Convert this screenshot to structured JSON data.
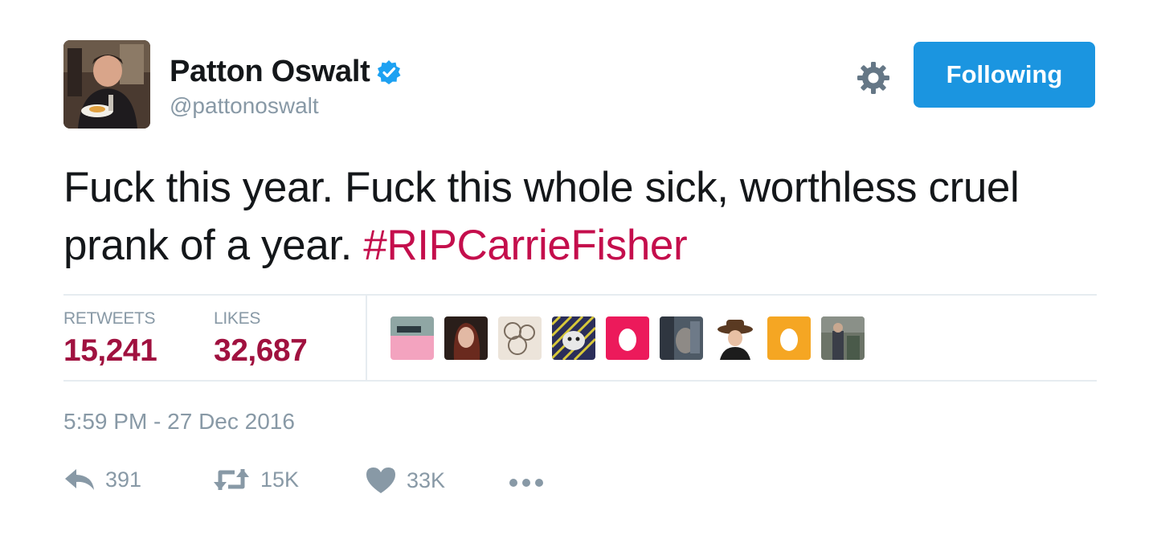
{
  "author": {
    "name": "Patton Oswalt",
    "handle": "@pattonoswalt",
    "verified": true
  },
  "header": {
    "settings_icon": "gear-icon",
    "follow_label": "Following"
  },
  "tweet": {
    "text_plain": "Fuck this year. Fuck this whole sick, worthless cruel prank of a year.",
    "hashtag": "#RIPCarrieFisher"
  },
  "stats": {
    "retweets_label": "RETWEETS",
    "retweets_value": "15,241",
    "likes_label": "LIKES",
    "likes_value": "32,687"
  },
  "timestamp": "5:59 PM - 27 Dec 2016",
  "actions": {
    "reply_count": "391",
    "retweet_count": "15K",
    "like_count": "33K"
  },
  "colors": {
    "accent": "#1b95e0",
    "hashtag": "#c40e4c",
    "stat_value": "#a0113f",
    "muted": "#8899a6",
    "divider": "#e6ecf0"
  }
}
